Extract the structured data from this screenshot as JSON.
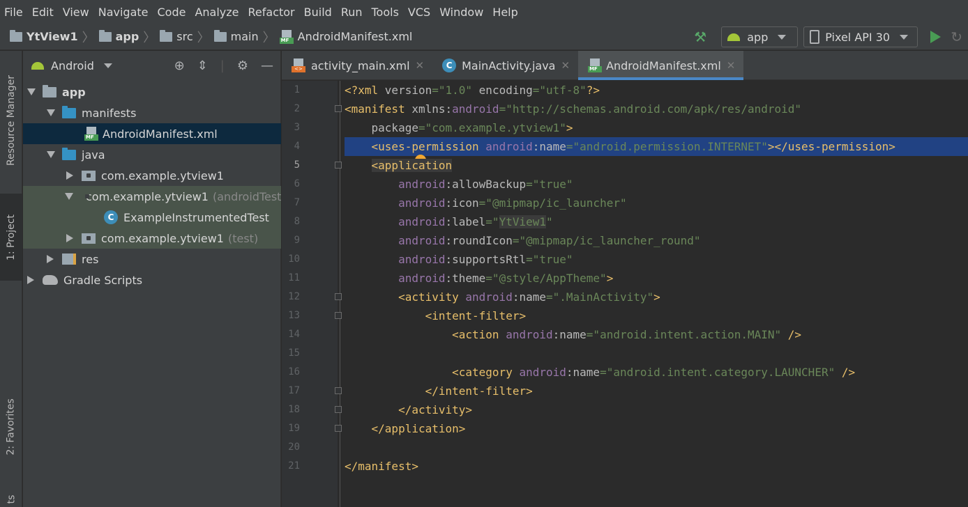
{
  "menu": {
    "items": [
      "File",
      "Edit",
      "View",
      "Navigate",
      "Code",
      "Analyze",
      "Refactor",
      "Build",
      "Run",
      "Tools",
      "VCS",
      "Window",
      "Help"
    ]
  },
  "breadcrumb": {
    "project": "YtView1",
    "module": "app",
    "src": "src",
    "main": "main",
    "file": "AndroidManifest.xml"
  },
  "toolbar": {
    "run_config": "app",
    "device": "Pixel API 30"
  },
  "stripe": {
    "resource_manager": "Resource Manager",
    "project": "1: Project",
    "favorites": "2: Favorites",
    "bottom_cut": "ts"
  },
  "project_panel": {
    "view_mode": "Android",
    "tree": {
      "app": "app",
      "manifests": "manifests",
      "manifest_file": "AndroidManifest.xml",
      "java": "java",
      "pkg_main": "com.example.ytview1",
      "pkg_android_test": "com.example.ytview1",
      "pkg_android_test_suffix": "(androidTest)",
      "test_class": "ExampleInstrumentedTest",
      "pkg_test": "com.example.ytview1",
      "pkg_test_suffix": "(test)",
      "res": "res",
      "gradle": "Gradle Scripts"
    }
  },
  "tabs": [
    {
      "label": "activity_main.xml",
      "icon": "xml-layout-icon"
    },
    {
      "label": "MainActivity.java",
      "icon": "java-class-icon"
    },
    {
      "label": "AndroidManifest.xml",
      "icon": "manifest-icon",
      "active": true
    }
  ],
  "editor": {
    "current_line": 5,
    "lines": [
      "1",
      "2",
      "3",
      "4",
      "5",
      "6",
      "7",
      "8",
      "9",
      "10",
      "11",
      "12",
      "13",
      "14",
      "15",
      "16",
      "17",
      "18",
      "19",
      "20",
      "21"
    ]
  },
  "colors": {
    "tag": "#e8bf6a",
    "namespace": "#9876aa",
    "attr_value": "#6a8759",
    "selection": "#214283",
    "accent": "#4a88c7"
  }
}
